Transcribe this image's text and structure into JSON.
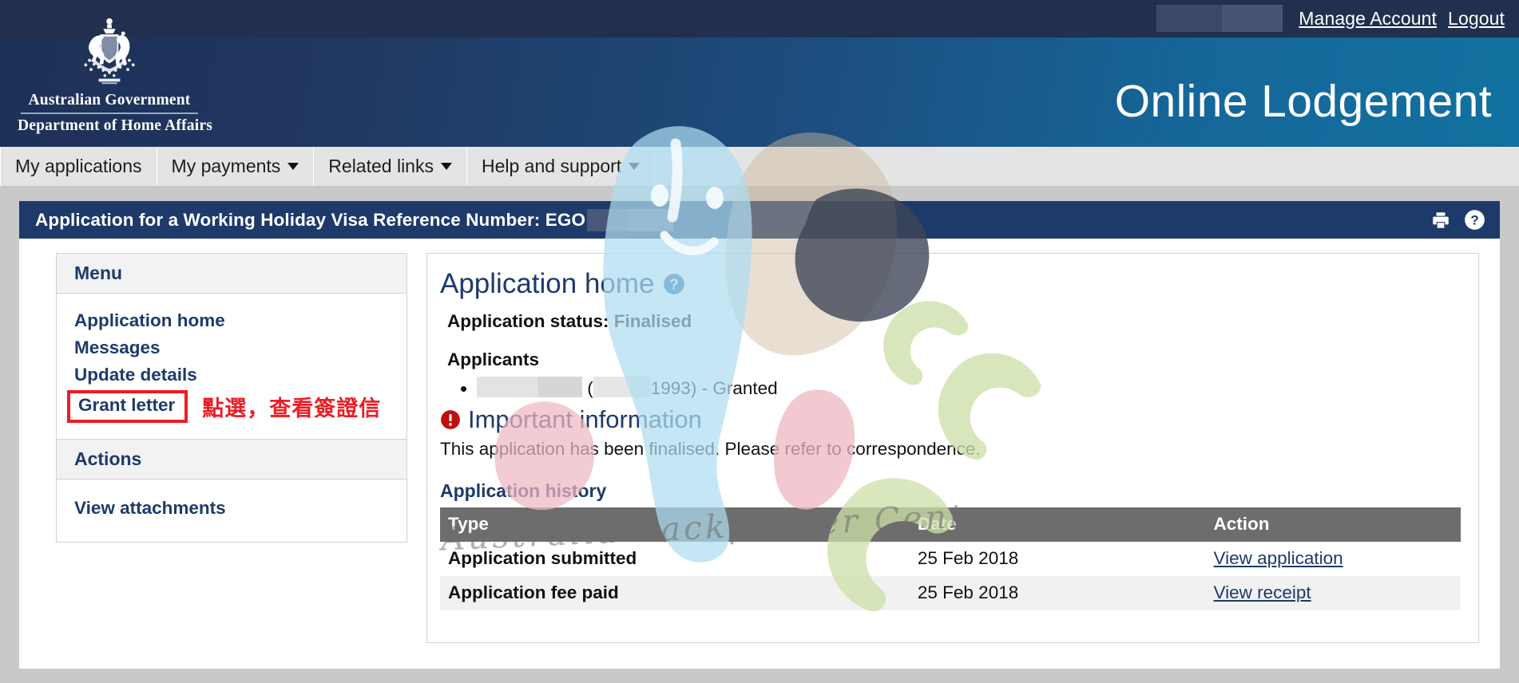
{
  "header": {
    "utility": {
      "manage_account": "Manage Account",
      "logout": "Logout",
      "account_redacted": ""
    },
    "crest": {
      "line1": "Australian Government",
      "line2": "Department of Home Affairs",
      "emblem_icon": "australian-coat-of-arms-icon"
    },
    "site_title": "Online Lodgement"
  },
  "nav": {
    "items": [
      {
        "label": "My applications",
        "has_caret": false
      },
      {
        "label": "My payments",
        "has_caret": true
      },
      {
        "label": "Related links",
        "has_caret": true
      },
      {
        "label": "Help and support",
        "has_caret": true
      }
    ]
  },
  "app_bar": {
    "title": "Application for a Working Holiday Visa Reference Number: EGO",
    "reference_redacted": "",
    "print_icon": "printer-icon",
    "help_icon": "help-circle-icon"
  },
  "sidebar": {
    "menu_heading": "Menu",
    "menu_items": [
      {
        "label": "Application home"
      },
      {
        "label": "Messages"
      },
      {
        "label": "Update details"
      },
      {
        "label": "Grant letter",
        "highlighted": true
      }
    ],
    "annotation": "點選，查看簽證信",
    "actions_heading": "Actions",
    "actions_items": [
      {
        "label": "View attachments"
      }
    ]
  },
  "main": {
    "page_title": "Application home",
    "page_title_help_icon": "help-circle-icon",
    "status_label": "Application status: Finalised",
    "applicants_heading": "Applicants",
    "applicants": [
      {
        "name_redacted": "",
        "open_paren": "(",
        "dob_redacted": "",
        "year": "1993",
        "close_paren": ")",
        "outcome": "- Granted"
      }
    ],
    "important_icon": "alert-exclamation-icon",
    "important_heading": "Important information",
    "important_text": "This application has been finalised. Please refer to correspondence.",
    "history_title": "Application history",
    "history_columns": [
      "Type",
      "Date",
      "Action"
    ],
    "history_rows": [
      {
        "type": "Application submitted",
        "date": "25 Feb 2018",
        "action": "View application"
      },
      {
        "type": "Application fee paid",
        "date": "25 Feb 2018",
        "action": "View receipt"
      }
    ]
  },
  "watermark": {
    "text": "Australia Backpacker Center"
  },
  "colors": {
    "header_dark": "#1d3058",
    "header_light": "#11719f",
    "utility_bar": "#22304f",
    "app_bar": "#1d3a6b",
    "nav_bg": "#e4e4e4",
    "brand_blue": "#1d3a6b",
    "annotation_red": "#ed1c24",
    "table_header": "#6d6d6d",
    "page_bg": "#c9c9c9"
  }
}
